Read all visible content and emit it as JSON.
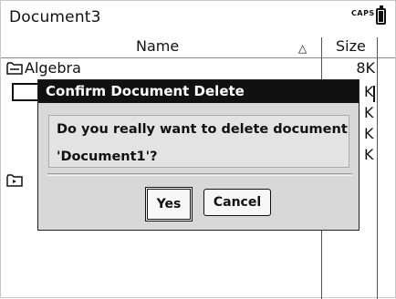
{
  "titlebar": {
    "document_title": "Document3",
    "caps_indicator": "CAPS"
  },
  "list_header": {
    "name_label": "Name",
    "size_label": "Size",
    "sort_indicator": "△"
  },
  "rows": [
    {
      "name": "Algebra",
      "size": "8K"
    }
  ],
  "partial_sizes": [
    "K",
    "K",
    "K",
    "K"
  ],
  "dialog": {
    "title": "Confirm Document Delete",
    "message_line1": "Do you really want to delete document",
    "message_line2": "'Document1'?",
    "yes_label": "Yes",
    "cancel_label": "Cancel"
  }
}
